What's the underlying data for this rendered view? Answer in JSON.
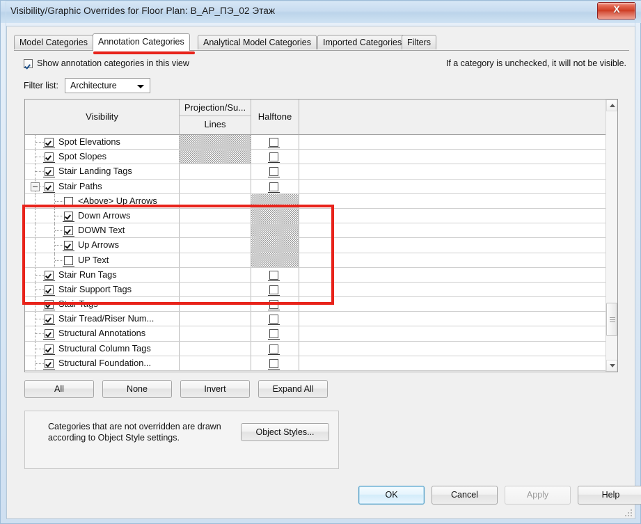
{
  "window": {
    "title": "Visibility/Graphic Overrides for Floor Plan: В_АР_ПЭ_02 Этаж",
    "close_glyph": "X"
  },
  "tabs": [
    {
      "label": "Model Categories",
      "active": false
    },
    {
      "label": "Annotation Categories",
      "active": true
    },
    {
      "label": "Analytical Model Categories",
      "active": false
    },
    {
      "label": "Imported Categories",
      "active": false
    },
    {
      "label": "Filters",
      "active": false
    }
  ],
  "options": {
    "show_categories_label": "Show annotation categories in this view",
    "show_categories_checked": true,
    "hint": "If a category is unchecked, it will not be visible.",
    "filter_label": "Filter list:",
    "filter_value": "Architecture"
  },
  "table": {
    "headers": {
      "visibility": "Visibility",
      "projection": "Projection/Su...",
      "lines": "Lines",
      "halftone": "Halftone"
    },
    "rows": [
      {
        "label": "Spot Elevations",
        "level": 0,
        "checked": true,
        "expander": "none",
        "lines_hatched": true,
        "halftone": true,
        "halftone_checked": false,
        "half_hatched": false
      },
      {
        "label": "Spot Slopes",
        "level": 0,
        "checked": true,
        "expander": "none",
        "lines_hatched": true,
        "halftone": true,
        "halftone_checked": false,
        "half_hatched": false
      },
      {
        "label": "Stair Landing Tags",
        "level": 0,
        "checked": true,
        "expander": "none",
        "lines_hatched": false,
        "halftone": true,
        "halftone_checked": false,
        "half_hatched": false
      },
      {
        "label": "Stair Paths",
        "level": 0,
        "checked": true,
        "expander": "minus",
        "lines_hatched": false,
        "halftone": true,
        "halftone_checked": false,
        "half_hatched": false
      },
      {
        "label": "<Above> Up Arrows",
        "level": 1,
        "checked": false,
        "expander": "none",
        "lines_hatched": false,
        "halftone": false,
        "halftone_checked": false,
        "half_hatched": true
      },
      {
        "label": "Down Arrows",
        "level": 1,
        "checked": true,
        "expander": "none",
        "lines_hatched": false,
        "halftone": false,
        "halftone_checked": false,
        "half_hatched": true
      },
      {
        "label": "DOWN Text",
        "level": 1,
        "checked": true,
        "expander": "none",
        "lines_hatched": false,
        "halftone": false,
        "halftone_checked": false,
        "half_hatched": true
      },
      {
        "label": "Up Arrows",
        "level": 1,
        "checked": true,
        "expander": "none",
        "lines_hatched": false,
        "halftone": false,
        "halftone_checked": false,
        "half_hatched": true
      },
      {
        "label": "UP Text",
        "level": 1,
        "checked": false,
        "expander": "none",
        "lines_hatched": false,
        "halftone": false,
        "halftone_checked": false,
        "half_hatched": true
      },
      {
        "label": "Stair Run Tags",
        "level": 0,
        "checked": true,
        "expander": "none",
        "lines_hatched": false,
        "halftone": true,
        "halftone_checked": false,
        "half_hatched": false
      },
      {
        "label": "Stair Support Tags",
        "level": 0,
        "checked": true,
        "expander": "none",
        "lines_hatched": false,
        "halftone": true,
        "halftone_checked": false,
        "half_hatched": false
      },
      {
        "label": "Stair Tags",
        "level": 0,
        "checked": true,
        "expander": "none",
        "lines_hatched": false,
        "halftone": true,
        "halftone_checked": false,
        "half_hatched": false
      },
      {
        "label": "Stair Tread/Riser Num...",
        "level": 0,
        "checked": true,
        "expander": "none",
        "lines_hatched": false,
        "halftone": true,
        "halftone_checked": false,
        "half_hatched": false
      },
      {
        "label": "Structural Annotations",
        "level": 0,
        "checked": true,
        "expander": "none",
        "lines_hatched": false,
        "halftone": true,
        "halftone_checked": false,
        "half_hatched": false
      },
      {
        "label": "Structural Column Tags",
        "level": 0,
        "checked": true,
        "expander": "none",
        "lines_hatched": false,
        "halftone": true,
        "halftone_checked": false,
        "half_hatched": false
      },
      {
        "label": "Structural Foundation...",
        "level": 0,
        "checked": true,
        "expander": "none",
        "lines_hatched": false,
        "halftone": true,
        "halftone_checked": false,
        "half_hatched": false
      }
    ]
  },
  "mid_buttons": {
    "all": "All",
    "none": "None",
    "invert": "Invert",
    "expand_all": "Expand All"
  },
  "object_styles": {
    "description": "Categories that are not overridden are drawn according to Object Style settings.",
    "button": "Object Styles..."
  },
  "footer": {
    "ok": "OK",
    "cancel": "Cancel",
    "apply": "Apply",
    "help": "Help"
  },
  "annotations": {
    "highlight_color": "#e8231b"
  }
}
